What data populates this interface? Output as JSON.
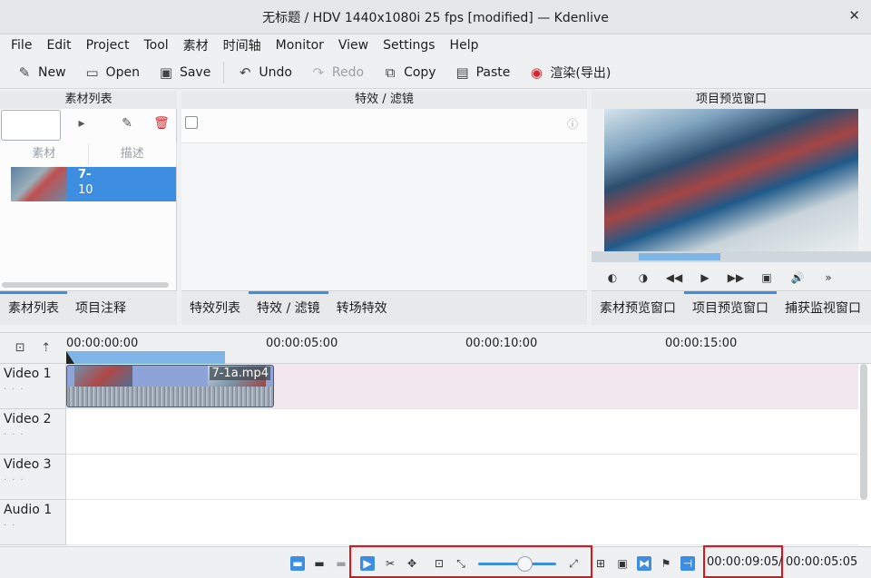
{
  "window": {
    "title": "无标题 / HDV 1440x1080i 25 fps [modified] — Kdenlive",
    "close_glyph": "✕"
  },
  "menu": [
    "File",
    "Edit",
    "Project",
    "Tool",
    "素材",
    "时间轴",
    "Monitor",
    "View",
    "Settings",
    "Help"
  ],
  "toolbar": {
    "new": "New",
    "open": "Open",
    "save": "Save",
    "undo": "Undo",
    "redo": "Redo",
    "copy": "Copy",
    "paste": "Paste",
    "render": "渲染(导出)"
  },
  "bin": {
    "title": "素材列表",
    "columns": [
      "素材",
      "描述"
    ],
    "clip": {
      "name": "7-",
      "duration": "10"
    }
  },
  "effects": {
    "title": "特效 / 滤镜"
  },
  "monitor": {
    "title": "项目预览窗口"
  },
  "tabs_left": [
    "素材列表",
    "项目注释"
  ],
  "tabs_mid": [
    "特效列表",
    "特效 / 滤镜",
    "转场特效"
  ],
  "tabs_right": [
    "素材预览窗口",
    "项目预览窗口",
    "捕获监视窗口"
  ],
  "timeline": {
    "ruler": [
      "00:00:00:00",
      "00:00:05:00",
      "00:00:10:00",
      "00:00:15:00"
    ],
    "tracks": [
      "Video 1",
      "Video 2",
      "Video 3",
      "Audio 1"
    ],
    "clip_name": "7-1a.mp4"
  },
  "status": {
    "position": "00:00:09:05",
    "separator": "/",
    "duration": "00:00:05:05"
  },
  "colors": {
    "accent": "#3d8ee0",
    "highlight_box": "#e0131a",
    "track1_bg": "#f3e7ee"
  }
}
